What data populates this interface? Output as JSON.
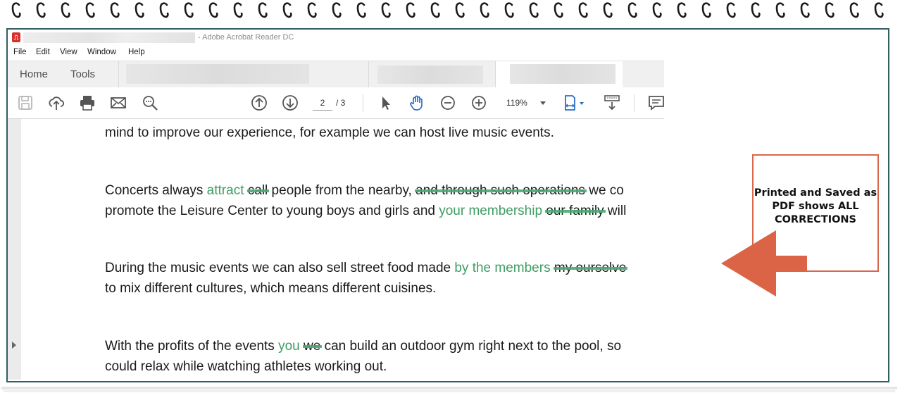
{
  "window": {
    "title_suffix": "- Adobe Acrobat Reader DC"
  },
  "menu": [
    "File",
    "Edit",
    "View",
    "Window",
    "Help"
  ],
  "tabs": {
    "home": "Home",
    "tools": "Tools"
  },
  "toolbar": {
    "current_page": "2",
    "page_total": "/ 3",
    "zoom": "119%"
  },
  "document": {
    "lines": [
      {
        "segments": [
          {
            "t": "mind to improve our experience, for example we can host live music events.",
            "k": "n"
          }
        ]
      },
      {
        "segments": [
          {
            "t": "Concerts always ",
            "k": "n"
          },
          {
            "t": "attract",
            "k": "ins"
          },
          {
            "t": " ",
            "k": "n"
          },
          {
            "t": "call",
            "k": "del"
          },
          {
            "t": " people from the nearby, ",
            "k": "n"
          },
          {
            "t": "and through such operations",
            "k": "del"
          },
          {
            "t": " we co",
            "k": "n"
          }
        ]
      },
      {
        "segments": [
          {
            "t": "promote the Leisure Center to young boys and girls and ",
            "k": "n"
          },
          {
            "t": "your membership",
            "k": "ins"
          },
          {
            "t": " ",
            "k": "n"
          },
          {
            "t": "our family",
            "k": "del"
          },
          {
            "t": " will",
            "k": "n"
          }
        ]
      },
      {
        "segments": [
          {
            "t": "During the music events we can also sell street food made ",
            "k": "n"
          },
          {
            "t": "by the members",
            "k": "ins"
          },
          {
            "t": " ",
            "k": "n"
          },
          {
            "t": "my ourselve",
            "k": "del"
          }
        ]
      },
      {
        "segments": [
          {
            "t": "to mix different cultures, which means different cuisines.",
            "k": "n"
          }
        ]
      },
      {
        "segments": [
          {
            "t": "With the profits of the events ",
            "k": "n"
          },
          {
            "t": "you",
            "k": "ins"
          },
          {
            "t": " ",
            "k": "n"
          },
          {
            "t": "we",
            "k": "del"
          },
          {
            "t": " can build an outdoor gym right next to the pool, so",
            "k": "n"
          }
        ]
      },
      {
        "segments": [
          {
            "t": "could relax while watching athletes working out.",
            "k": "n"
          }
        ]
      }
    ]
  },
  "annotation": {
    "line1": "Printed and Saved as",
    "line2": "PDF shows ALL",
    "line3": "CORRECTIONS",
    "box_color": "#d9674a",
    "arrow_color": "#dc6446"
  },
  "colors": {
    "insert_text": "#3e9d63",
    "strike": "#4aa873",
    "frame": "#2f5f64"
  }
}
